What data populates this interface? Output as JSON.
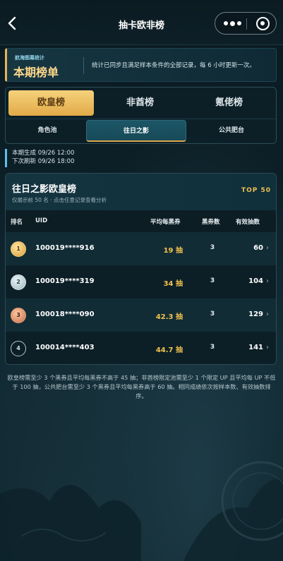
{
  "header": {
    "title": "抽卡欧非榜",
    "back_icon": "chevron-left-icon",
    "more_icon": "more-dots-icon",
    "close_icon": "target-circle-icon"
  },
  "banner": {
    "label": "航海图幕统计",
    "title": "本期榜单",
    "description": "统计已同步且满足样本条件的全部记录，每 6 小时更新一次。"
  },
  "tabs": [
    {
      "label": "欧皇榜",
      "active": true
    },
    {
      "label": "非酋榜",
      "active": false
    },
    {
      "label": "氪佬榜",
      "active": false
    }
  ],
  "subtabs": [
    {
      "label": "角色池",
      "active": false
    },
    {
      "label": "往日之影",
      "active": true
    },
    {
      "label": "公共肥台",
      "active": false
    }
  ],
  "times": {
    "generated": "本期生成 09/26 12:00",
    "next": "下次刷新 09/26 18:00"
  },
  "board": {
    "title": "往日之影欧皇榜",
    "subtitle": "仅展示前 50 名 · 点击任意记录查看分析",
    "badge": "TOP 50",
    "columns": {
      "rank": "排名",
      "uid": "UID",
      "avg": "平均每黑券",
      "limited": "黑券数",
      "effective": "有效抽数"
    },
    "rows": [
      {
        "rank": "1",
        "uid": "100019****916",
        "avg": "19 抽",
        "limited": "3",
        "effective": "60"
      },
      {
        "rank": "2",
        "uid": "100019****319",
        "avg": "34 抽",
        "limited": "3",
        "effective": "104"
      },
      {
        "rank": "3",
        "uid": "100018****090",
        "avg": "42.3 抽",
        "limited": "3",
        "effective": "129"
      },
      {
        "rank": "4",
        "uid": "100014****403",
        "avg": "44.7 抽",
        "limited": "3",
        "effective": "141"
      }
    ]
  },
  "note": "欧皇榜需至少 3 个黑券且平均每黑券不高于 45 抽；非酋榜限定池需至少 1 个限定 UP 且平均每 UP 不低于 100 抽，公共肥台需至少 3 个黑券且平均每黑券高于 60 抽。相同成绩依次按样本数、有效抽数排序。",
  "colors": {
    "accent_gold": "#e8b45a",
    "value_gold": "#f2c24f",
    "panel": "#112c35",
    "accent_blue": "#5fc0e8"
  }
}
